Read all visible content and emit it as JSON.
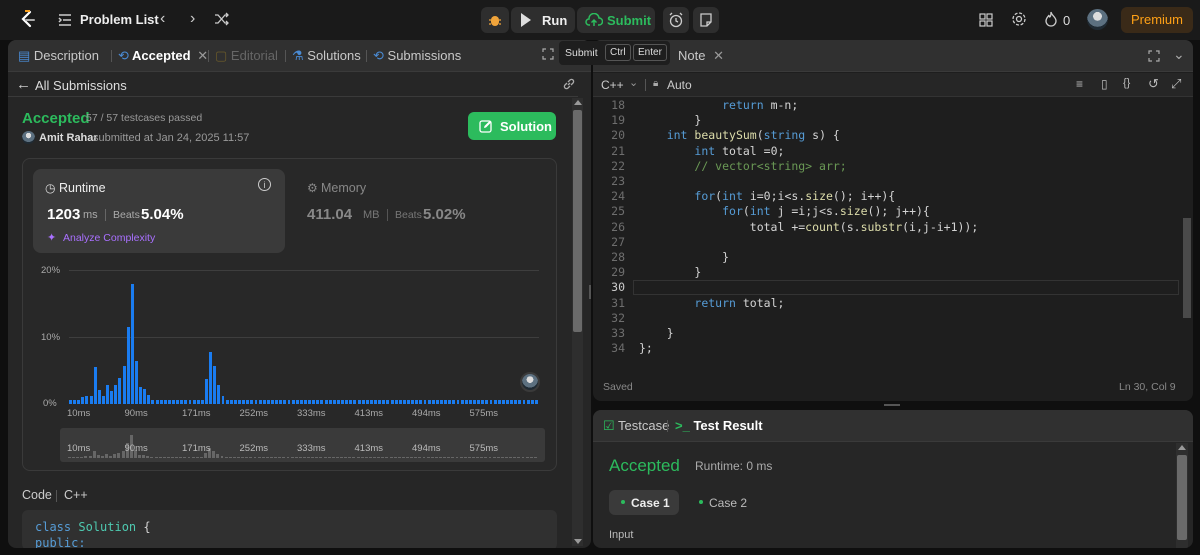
{
  "topbar": {
    "problem_list": "Problem List",
    "run": "Run",
    "submit": "Submit",
    "streak": "0",
    "premium": "Premium"
  },
  "tooltip": {
    "label": "Submit",
    "key1": "Ctrl",
    "key2": "Enter"
  },
  "left_tabs": [
    "Description",
    "Accepted",
    "Editorial",
    "Solutions",
    "Submissions"
  ],
  "submission": {
    "back": "All Submissions",
    "status": "Accepted",
    "testcases": "57 / 57 testcases passed",
    "user": "Amit Rahar",
    "submitted_at": "submitted at Jan 24, 2025 11:57",
    "solution_btn": "Solution"
  },
  "runtime": {
    "title": "Runtime",
    "value": "1203",
    "unit": "ms",
    "beats_label": "Beats",
    "beats": "5.04%",
    "analyze": "Analyze Complexity"
  },
  "memory": {
    "title": "Memory",
    "value": "411.04",
    "unit": "MB",
    "beats_label": "Beats",
    "beats": "5.02%"
  },
  "chart_data": {
    "type": "bar",
    "ylabels": [
      "20%",
      "10%",
      "0%"
    ],
    "ylim": [
      0,
      20
    ],
    "xlabels": [
      "10ms",
      "90ms",
      "171ms",
      "252ms",
      "333ms",
      "413ms",
      "494ms",
      "575ms"
    ],
    "values": [
      0.6,
      0.6,
      0.6,
      1,
      1.2,
      1.2,
      5.5,
      2.1,
      1.2,
      2.8,
      1.9,
      2.8,
      3.9,
      5.6,
      11.5,
      17.9,
      6.4,
      2.6,
      2.3,
      1.3,
      0.6,
      0.6,
      0.6,
      0.6,
      0.6,
      0.6,
      0.6,
      0.6,
      0.6,
      0.6,
      0.6,
      0.6,
      0.6,
      3.8,
      7.8,
      5.6,
      2.8,
      1.2,
      0.6,
      0.6,
      0.6,
      0.6,
      0.6,
      0.6,
      0.6,
      0.6,
      0.6,
      0.6,
      0.6,
      0.6,
      0.6,
      0.6,
      0.6,
      0.6,
      0.6,
      0.6,
      0.6,
      0.6,
      0.6,
      0.6,
      0.6,
      0.6,
      0.6,
      0.6,
      0.6,
      0.6,
      0.6,
      0.6,
      0.6,
      0.6,
      0.6,
      0.6,
      0.6,
      0.6,
      0.6,
      0.6,
      0.6,
      0.6,
      0.6,
      0.6,
      0.6,
      0.6,
      0.6,
      0.6,
      0.6,
      0.6,
      0.6,
      0.6,
      0.6,
      0.6,
      0.6,
      0.6,
      0.6,
      0.6,
      0.6,
      0.6,
      0.6,
      0.6,
      0.6,
      0.6,
      0.6,
      0.6,
      0.6,
      0.6,
      0.6,
      0.6,
      0.6,
      0.6,
      0.6,
      0.6,
      0.6,
      0.6,
      0.6,
      0.6
    ],
    "mini_xlabels": [
      "10ms",
      "90ms",
      "171ms",
      "252ms",
      "333ms",
      "413ms",
      "494ms",
      "575ms"
    ]
  },
  "code_section": {
    "label": "Code",
    "lang": "C++",
    "line1": "class Solution {",
    "line2": "public:"
  },
  "editor": {
    "tab_note": "Note",
    "lang": "C++",
    "mode": "Auto",
    "status_saved": "Saved",
    "cursor": "Ln 30, Col 9",
    "lines": [
      {
        "n": "18",
        "html": "            <span class=\"kw\">return</span> <span class=\"pl\">m-n;</span>"
      },
      {
        "n": "19",
        "html": "        <span class=\"pl\">}</span>"
      },
      {
        "n": "20",
        "html": "    <span class=\"kw\">int</span> <span class=\"fn\">beautySum</span><span class=\"pl\">(</span><span class=\"kw\">string</span> <span class=\"pl\">s) {</span>"
      },
      {
        "n": "21",
        "html": "        <span class=\"kw\">int</span> <span class=\"pl\">total =0;</span>"
      },
      {
        "n": "22",
        "html": "        <span class=\"cm\">// vector&lt;string&gt; arr;</span>"
      },
      {
        "n": "23",
        "html": ""
      },
      {
        "n": "24",
        "html": "        <span class=\"kw\">for</span><span class=\"pl\">(</span><span class=\"kw\">int</span> <span class=\"pl\">i=0;i&lt;s.</span><span class=\"fn\">size</span><span class=\"pl\">(); i++){</span>"
      },
      {
        "n": "25",
        "html": "            <span class=\"kw\">for</span><span class=\"pl\">(</span><span class=\"kw\">int</span> <span class=\"pl\">j =i;j&lt;s.</span><span class=\"fn\">size</span><span class=\"pl\">(); j++){</span>"
      },
      {
        "n": "26",
        "html": "                <span class=\"pl\">total +=</span><span class=\"fn\">count</span><span class=\"pl\">(s.</span><span class=\"fn\">substr</span><span class=\"pl\">(i,j-i+1));</span>"
      },
      {
        "n": "27",
        "html": ""
      },
      {
        "n": "28",
        "html": "            <span class=\"pl\">}</span>"
      },
      {
        "n": "29",
        "html": "        <span class=\"pl\">}</span>"
      },
      {
        "n": "30",
        "html": ""
      },
      {
        "n": "31",
        "html": "        <span class=\"kw\">return</span> <span class=\"pl\">total;</span>"
      },
      {
        "n": "32",
        "html": ""
      },
      {
        "n": "33",
        "html": "    <span class=\"pl\">}</span>"
      },
      {
        "n": "34",
        "html": "<span class=\"pl\">};</span>"
      }
    ]
  },
  "result": {
    "tab_testcase": "Testcase",
    "tab_result": "Test Result",
    "status": "Accepted",
    "runtime": "Runtime: 0 ms",
    "case1": "Case 1",
    "case2": "Case 2",
    "input_label": "Input"
  }
}
